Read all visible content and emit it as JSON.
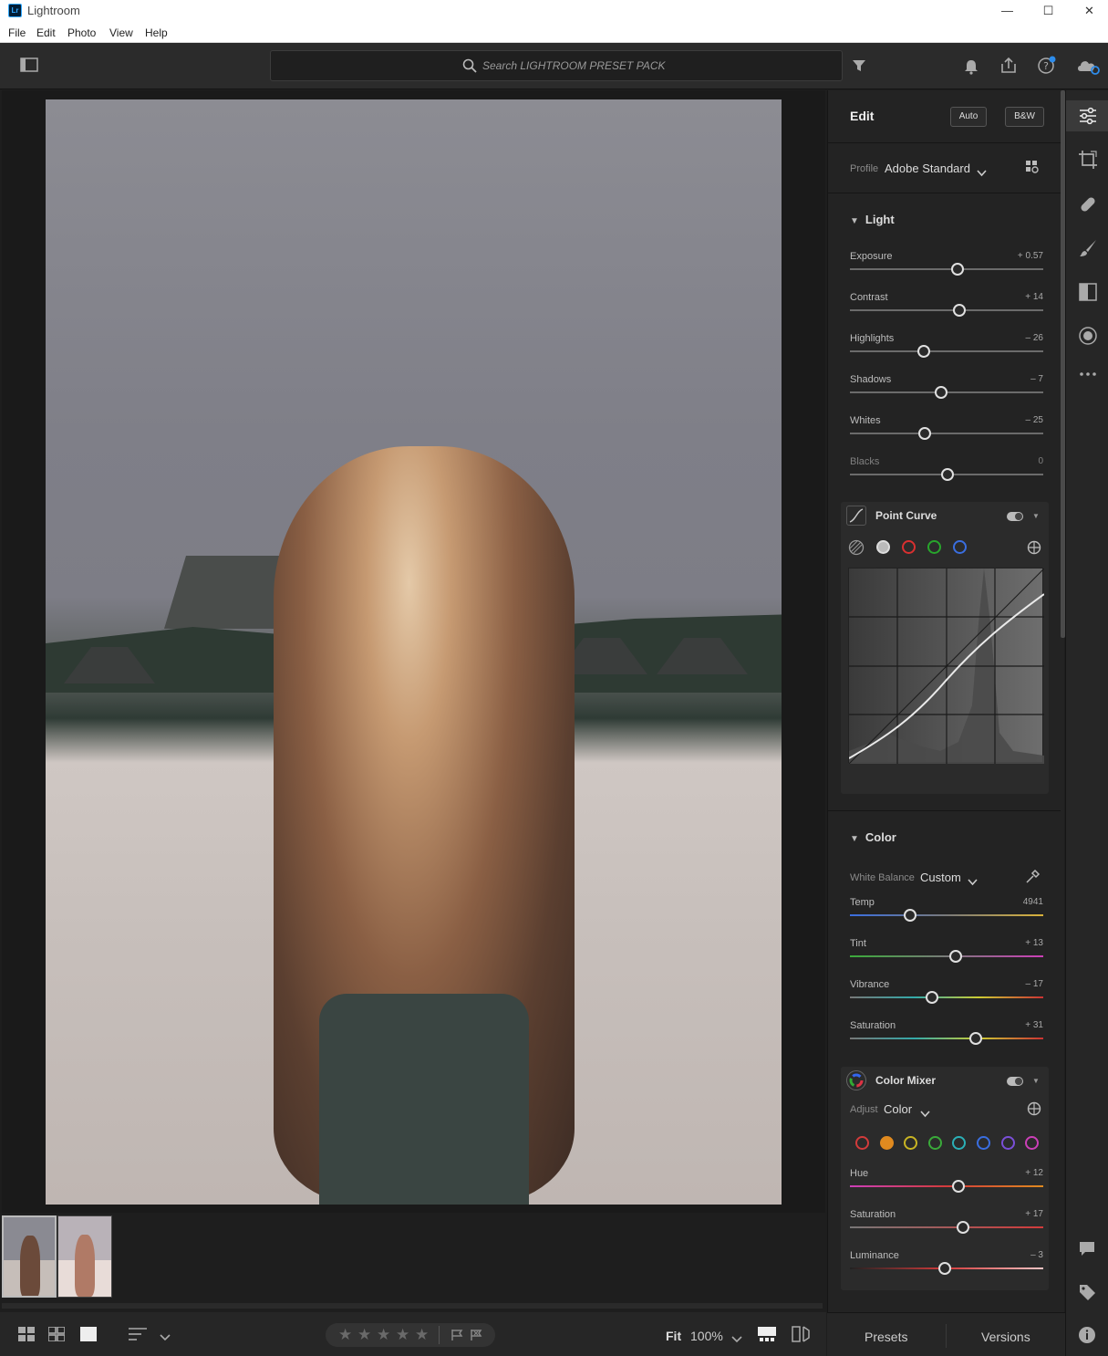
{
  "window": {
    "title": "Lightroom",
    "logo_text": "Lr",
    "controls": [
      "—",
      "☐",
      "✕"
    ]
  },
  "menu": [
    "File",
    "Edit",
    "Photo",
    "View",
    "Help"
  ],
  "toolbar": {
    "search_placeholder": "Search LIGHTROOM PRESET PACK"
  },
  "edit": {
    "title": "Edit",
    "auto_label": "Auto",
    "bw_label": "B&W",
    "profile_label": "Profile",
    "profile_value": "Adobe Standard"
  },
  "light": {
    "title": "Light",
    "sliders": [
      {
        "label": "Exposure",
        "value": "+ 0.57",
        "pos": 0.557
      },
      {
        "label": "Contrast",
        "value": "+ 14",
        "pos": 0.566
      },
      {
        "label": "Highlights",
        "value": "– 26",
        "pos": 0.382
      },
      {
        "label": "Shadows",
        "value": "– 7",
        "pos": 0.472
      },
      {
        "label": "Whites",
        "value": "– 25",
        "pos": 0.387
      },
      {
        "label": "Blacks",
        "value": "0",
        "pos": 0.505
      }
    ]
  },
  "point_curve": {
    "title": "Point Curve"
  },
  "color": {
    "title": "Color",
    "wb_label": "White Balance",
    "wb_value": "Custom",
    "sliders": [
      {
        "label": "Temp",
        "value": "4941",
        "pos": 0.311
      },
      {
        "label": "Tint",
        "value": "+ 13",
        "pos": 0.547
      },
      {
        "label": "Vibrance",
        "value": "– 17",
        "pos": 0.425
      },
      {
        "label": "Saturation",
        "value": "+ 31",
        "pos": 0.651
      }
    ]
  },
  "color_mixer": {
    "title": "Color Mixer",
    "adjust_label": "Adjust",
    "adjust_value": "Color",
    "swatches": [
      "#d33b3b",
      "#e08a1f",
      "#c8b423",
      "#3aaa3a",
      "#2bb0b7",
      "#3a6ee0",
      "#7a4fd8",
      "#cc3fb8"
    ],
    "sliders": [
      {
        "label": "Hue",
        "value": "+ 12",
        "pos": 0.561
      },
      {
        "label": "Saturation",
        "value": "+ 17",
        "pos": 0.585
      },
      {
        "label": "Luminance",
        "value": "– 3",
        "pos": 0.491
      }
    ]
  },
  "bottom": {
    "zoom_fit": "Fit",
    "zoom_pct": "100%",
    "presets_tab": "Presets",
    "versions_tab": "Versions"
  }
}
